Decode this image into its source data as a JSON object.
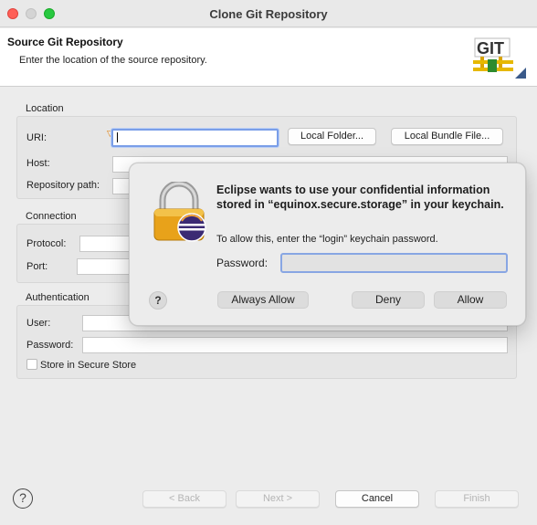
{
  "window": {
    "title": "Clone Git Repository"
  },
  "header": {
    "title": "Source Git Repository",
    "description": "Enter the location of the source repository.",
    "logo_text": "GIT"
  },
  "location": {
    "group_label": "Location",
    "uri_label": "URI:",
    "uri_value": "",
    "host_label": "Host:",
    "repo_path_label": "Repository path:",
    "local_folder_button": "Local Folder...",
    "local_bundle_button": "Local Bundle File..."
  },
  "connection": {
    "group_label": "Connection",
    "protocol_label": "Protocol:",
    "port_label": "Port:"
  },
  "authentication": {
    "group_label": "Authentication",
    "user_label": "User:",
    "password_label": "Password:",
    "store_label": "Store in Secure Store",
    "store_checked": false
  },
  "footer": {
    "back_button": "< Back",
    "next_button": "Next >",
    "cancel_button": "Cancel",
    "finish_button": "Finish"
  },
  "keychain_dialog": {
    "title": "Eclipse wants to use your confidential information stored in “equinox.secure.storage” in your keychain.",
    "message": "To allow this, enter the “login” keychain password.",
    "password_label": "Password:",
    "password_value": "",
    "always_allow_button": "Always Allow",
    "deny_button": "Deny",
    "allow_button": "Allow",
    "help_glyph": "?"
  },
  "icons": {
    "help": "?"
  },
  "colors": {
    "close": "#ff5f57",
    "maximize": "#28c840",
    "focus_ring": "#7a9ee8",
    "lock_gold": "#e8a21a",
    "eclipse_purple": "#3b2a73"
  }
}
